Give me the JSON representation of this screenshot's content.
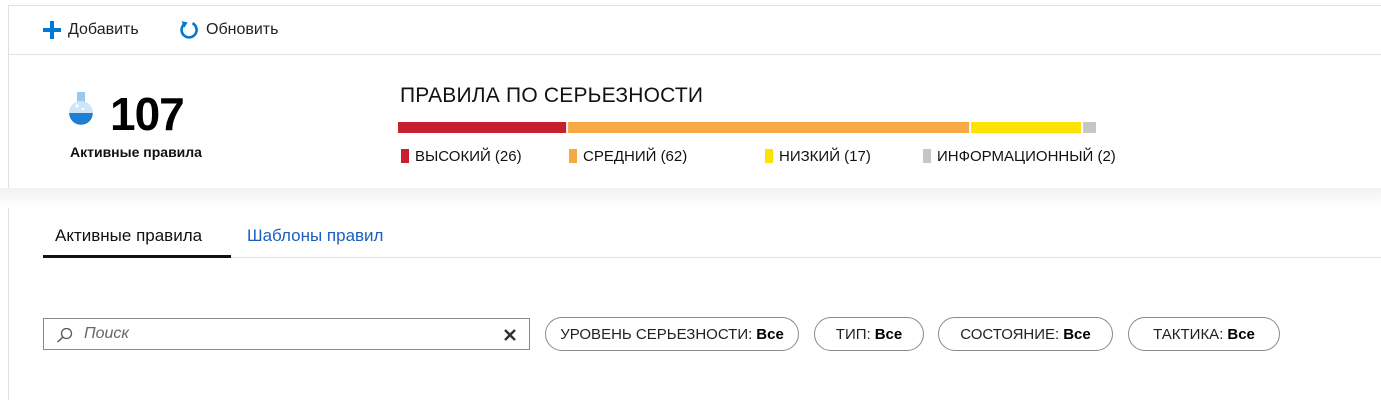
{
  "toolbar": {
    "add_label": "Добавить",
    "add_icon": "plus-icon",
    "refresh_label": "Обновить",
    "refresh_icon": "refresh-icon",
    "accent_color": "#0078d4"
  },
  "summary": {
    "active_count": "107",
    "active_label": "Активные правила",
    "flask_icon": "flask-icon"
  },
  "severity": {
    "title": "ПРАВИЛА ПО СЕРЬЕЗНОСТИ",
    "items": [
      {
        "label": "ВЫСОКИЙ (26)",
        "count": 26,
        "color": "#c8202e"
      },
      {
        "label": "СРЕДНИЙ (62)",
        "count": 62,
        "color": "#f7a944"
      },
      {
        "label": "НИЗКИЙ (17)",
        "count": 17,
        "color": "#fce300"
      },
      {
        "label": "ИНФОРМАЦИОННЫЙ (2)",
        "count": 2,
        "color": "#c6c6c6"
      }
    ]
  },
  "tabs": [
    {
      "label": "Активные правила",
      "active": true
    },
    {
      "label": "Шаблоны правил",
      "active": false
    }
  ],
  "filters": {
    "search_placeholder": "Поиск",
    "search_icon": "search-icon",
    "clear_icon": "close-icon",
    "pills": [
      {
        "name": "УРОВЕНЬ СЕРЬЕЗНОСТИ:",
        "value": "Все"
      },
      {
        "name": "ТИП:",
        "value": "Все"
      },
      {
        "name": "СОСТОЯНИЕ:",
        "value": "Все"
      },
      {
        "name": "ТАКТИКА:",
        "value": "Все"
      }
    ]
  }
}
